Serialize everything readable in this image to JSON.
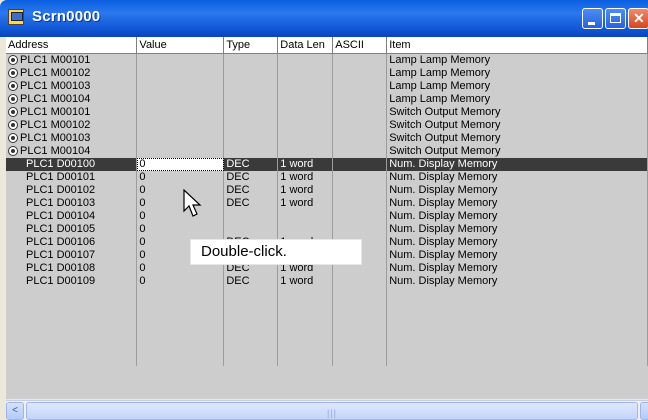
{
  "window": {
    "title": "Scrn0000",
    "icon": "screen-icon",
    "buttons": [
      "minimize",
      "maximize",
      "close"
    ]
  },
  "table": {
    "columns": [
      "Address",
      "Value",
      "Type",
      "Data Len",
      "ASCII",
      "Item"
    ],
    "rows": [
      {
        "bit_icon": true,
        "address": "PLC1 M00101",
        "value": "",
        "type": "",
        "data_len": "",
        "ascii": "",
        "item": "Lamp Lamp Memory"
      },
      {
        "bit_icon": true,
        "address": "PLC1 M00102",
        "value": "",
        "type": "",
        "data_len": "",
        "ascii": "",
        "item": "Lamp Lamp Memory"
      },
      {
        "bit_icon": true,
        "address": "PLC1 M00103",
        "value": "",
        "type": "",
        "data_len": "",
        "ascii": "",
        "item": "Lamp Lamp Memory"
      },
      {
        "bit_icon": true,
        "address": "PLC1 M00104",
        "value": "",
        "type": "",
        "data_len": "",
        "ascii": "",
        "item": "Lamp Lamp Memory"
      },
      {
        "bit_icon": true,
        "address": "PLC1 M00101",
        "value": "",
        "type": "",
        "data_len": "",
        "ascii": "",
        "item": "Switch Output Memory"
      },
      {
        "bit_icon": true,
        "address": "PLC1 M00102",
        "value": "",
        "type": "",
        "data_len": "",
        "ascii": "",
        "item": "Switch Output Memory"
      },
      {
        "bit_icon": true,
        "address": "PLC1 M00103",
        "value": "",
        "type": "",
        "data_len": "",
        "ascii": "",
        "item": "Switch Output Memory"
      },
      {
        "bit_icon": true,
        "address": "PLC1 M00104",
        "value": "",
        "type": "",
        "data_len": "",
        "ascii": "",
        "item": "Switch Output Memory"
      },
      {
        "bit_icon": false,
        "selected": true,
        "address": "PLC1 D00100",
        "value": "0",
        "type": "DEC",
        "data_len": "1 word",
        "ascii": "",
        "item": "Num. Display Memory"
      },
      {
        "bit_icon": false,
        "address": "PLC1 D00101",
        "value": "0",
        "type": "DEC",
        "data_len": "1 word",
        "ascii": "",
        "item": "Num. Display Memory"
      },
      {
        "bit_icon": false,
        "address": "PLC1 D00102",
        "value": "0",
        "type": "DEC",
        "data_len": "1 word",
        "ascii": "",
        "item": "Num. Display Memory"
      },
      {
        "bit_icon": false,
        "address": "PLC1 D00103",
        "value": "0",
        "type": "DEC",
        "data_len": "1 word",
        "ascii": "",
        "item": "Num. Display Memory"
      },
      {
        "bit_icon": false,
        "address": "PLC1 D00104",
        "value": "0",
        "type": "",
        "data_len": "",
        "ascii": "",
        "item": "Num. Display Memory"
      },
      {
        "bit_icon": false,
        "address": "PLC1 D00105",
        "value": "0",
        "type": "",
        "data_len": "",
        "ascii": "",
        "item": "Num. Display Memory"
      },
      {
        "bit_icon": false,
        "address": "PLC1 D00106",
        "value": "0",
        "type": "DEC",
        "data_len": "1 word",
        "ascii": "",
        "item": "Num. Display Memory"
      },
      {
        "bit_icon": false,
        "address": "PLC1 D00107",
        "value": "0",
        "type": "DEC",
        "data_len": "1 word",
        "ascii": "",
        "item": "Num. Display Memory"
      },
      {
        "bit_icon": false,
        "address": "PLC1 D00108",
        "value": "0",
        "type": "DEC",
        "data_len": "1 word",
        "ascii": "",
        "item": "Num. Display Memory"
      },
      {
        "bit_icon": false,
        "address": "PLC1 D00109",
        "value": "0",
        "type": "DEC",
        "data_len": "1 word",
        "ascii": "",
        "item": "Num. Display Memory"
      }
    ],
    "empty_rows": 6
  },
  "annotation": {
    "text": "Double-click."
  },
  "scrollbar": {
    "orientation": "horizontal"
  }
}
